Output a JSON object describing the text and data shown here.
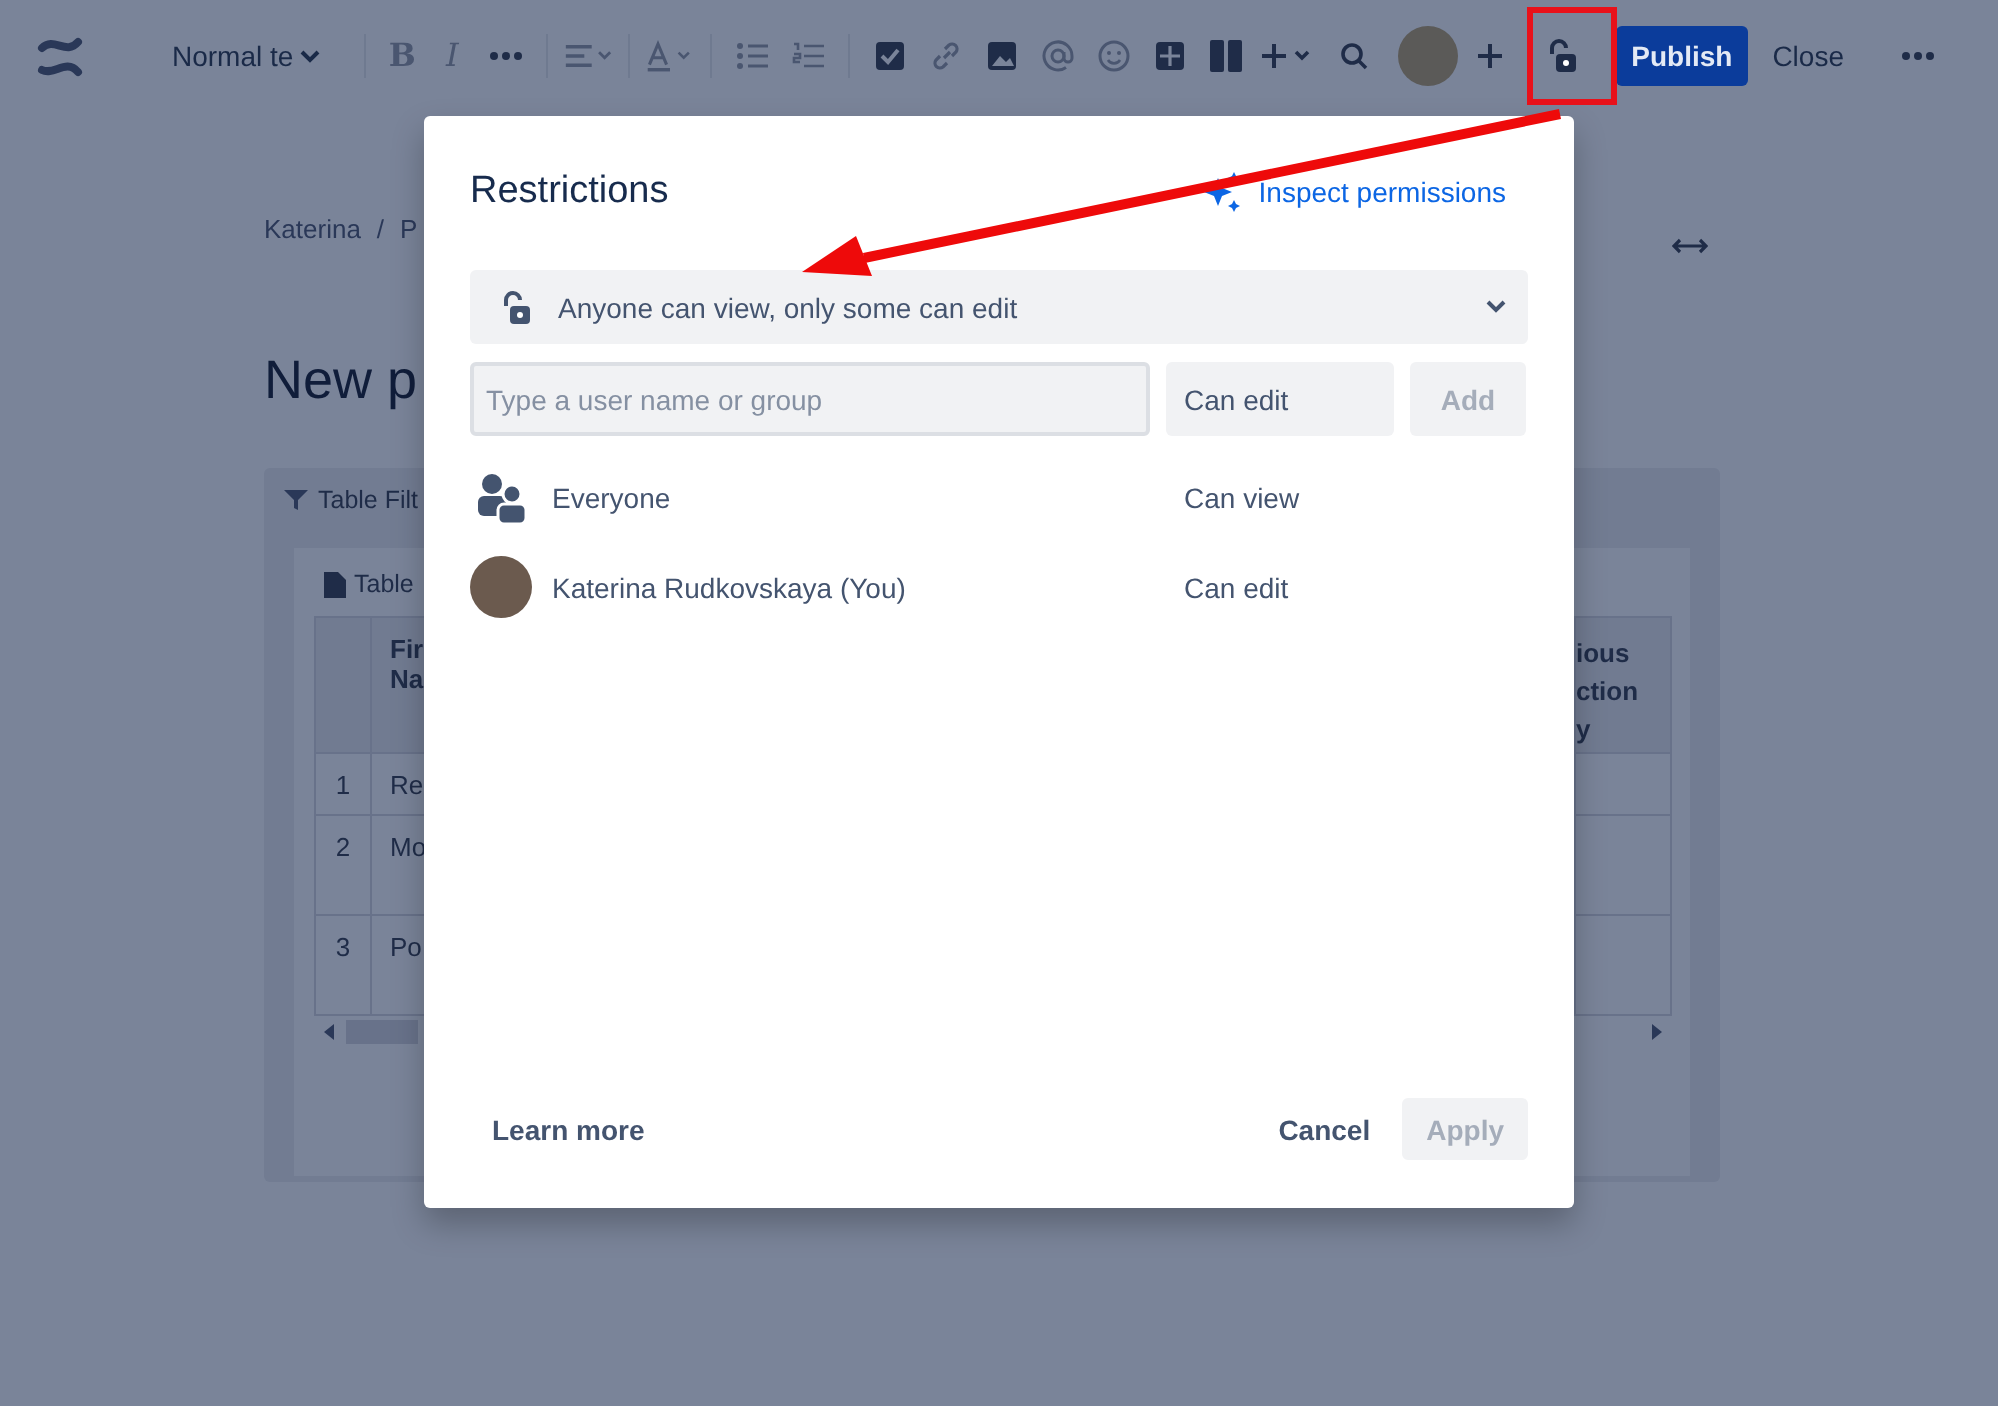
{
  "toolbar": {
    "text_style": "Normal te",
    "format_buttons": [
      {
        "label": "B",
        "kind": "bold"
      },
      {
        "label": "I",
        "kind": "italic"
      }
    ],
    "publish": "Publish",
    "close": "Close"
  },
  "page": {
    "breadcrumb": [
      "Katerina",
      "/",
      "P"
    ],
    "title": "New p",
    "macro_label": "Table Filt",
    "inner_label": "Table",
    "table": {
      "header": {
        "name": "Fir Na",
        "right": "ious ction y"
      },
      "rows": [
        {
          "index": "1",
          "name": "Re"
        },
        {
          "index": "2",
          "name": "Mo"
        },
        {
          "index": "3",
          "name": "Po"
        }
      ]
    }
  },
  "dialog": {
    "title": "Restrictions",
    "inspect_link": "Inspect permissions",
    "restriction": "Anyone can view, only some can edit",
    "search": {
      "placeholder": "Type a user name or group"
    },
    "permission": "Can edit",
    "add": {
      "label": "Add",
      "disabled": true
    },
    "entries": [
      {
        "name": "Everyone",
        "kind": "group",
        "access": "Can view"
      },
      {
        "name": "Katerina Rudkovskaya (You)",
        "kind": "user",
        "access": "Can edit"
      }
    ],
    "learn_more": "Learn more",
    "cancel": "Cancel",
    "apply": {
      "label": "Apply",
      "disabled": true
    }
  }
}
